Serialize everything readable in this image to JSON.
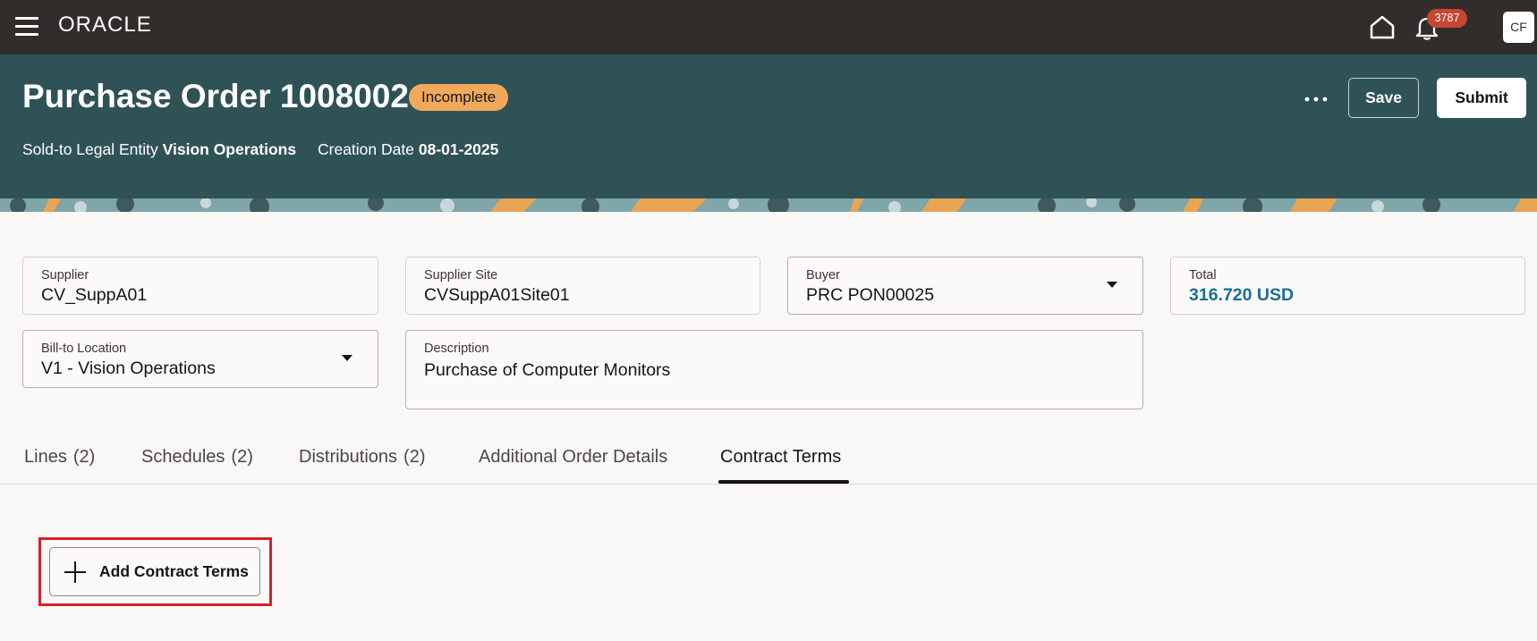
{
  "topbar": {
    "logo": "ORACLE",
    "notification_count": "3787",
    "avatar_initials": "CF"
  },
  "header": {
    "title": "Purchase Order 1008002",
    "status": "Incomplete",
    "legal_entity_label": "Sold-to Legal Entity",
    "legal_entity_value": "Vision Operations",
    "creation_date_label": "Creation Date",
    "creation_date_value": "08-01-2025",
    "save_label": "Save",
    "submit_label": "Submit"
  },
  "fields": {
    "supplier": {
      "label": "Supplier",
      "value": "CV_SuppA01"
    },
    "supplier_site": {
      "label": "Supplier Site",
      "value": "CVSuppA01Site01"
    },
    "buyer": {
      "label": "Buyer",
      "value": "PRC PON00025"
    },
    "total": {
      "label": "Total",
      "value": "316.720 USD"
    },
    "bill_to": {
      "label": "Bill-to Location",
      "value": "V1 - Vision Operations"
    },
    "description": {
      "label": "Description",
      "value": "Purchase of Computer Monitors"
    }
  },
  "tabs": [
    {
      "label": "Lines",
      "count": "(2)"
    },
    {
      "label": "Schedules",
      "count": "(2)"
    },
    {
      "label": "Distributions",
      "count": "(2)"
    },
    {
      "label": "Additional Order Details",
      "count": ""
    },
    {
      "label": "Contract Terms",
      "count": ""
    }
  ],
  "contract_terms": {
    "add_label": "Add Contract Terms"
  },
  "colors": {
    "topbar": "#312d2a",
    "header": "#2f5257",
    "status_badge": "#f0a95b",
    "notification_badge": "#c74634",
    "highlight": "#d4202c",
    "total_value": "#1a6e91"
  }
}
